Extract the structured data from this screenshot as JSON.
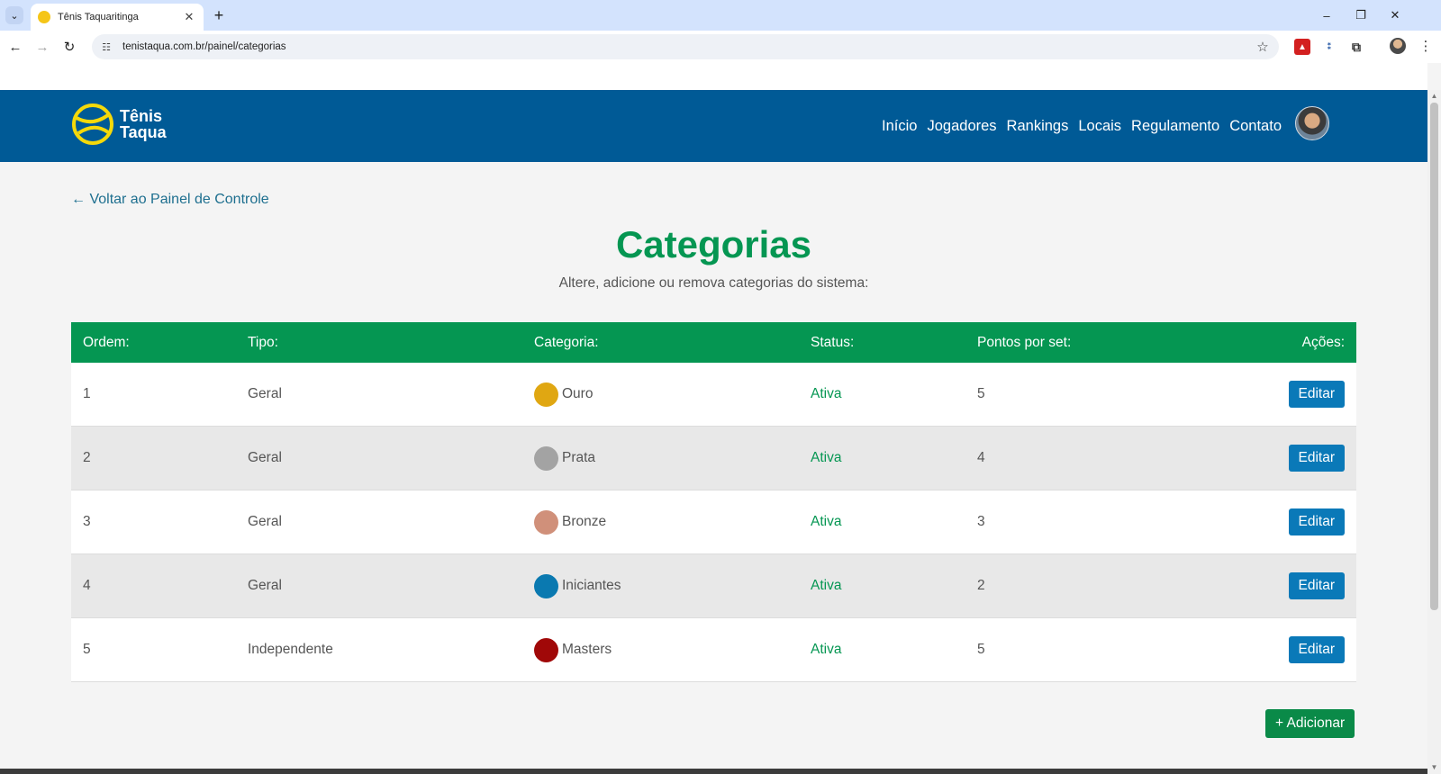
{
  "browser": {
    "tab_title": "Tênis Taquaritinga",
    "url": "tenistaqua.com.br/painel/categorias"
  },
  "header": {
    "logo_line1": "Tênis",
    "logo_line2": "Taqua",
    "nav": [
      "Início",
      "Jogadores",
      "Rankings",
      "Locais",
      "Regulamento",
      "Contato"
    ]
  },
  "page": {
    "back_link": "← Voltar ao Painel de Controle",
    "title": "Categorias",
    "subtitle": "Altere, adicione ou remova categorias do sistema:"
  },
  "table": {
    "headers": {
      "ordem": "Ordem:",
      "tipo": "Tipo:",
      "categoria": "Categoria:",
      "status": "Status:",
      "pontos": "Pontos por set:",
      "acoes": "Ações:"
    },
    "rows": [
      {
        "ordem": "1",
        "tipo": "Geral",
        "categoria": "Ouro",
        "color": "#e0a712",
        "status": "Ativa",
        "pontos": "5",
        "action": "Editar"
      },
      {
        "ordem": "2",
        "tipo": "Geral",
        "categoria": "Prata",
        "color": "#a3a3a3",
        "status": "Ativa",
        "pontos": "4",
        "action": "Editar"
      },
      {
        "ordem": "3",
        "tipo": "Geral",
        "categoria": "Bronze",
        "color": "#d0907a",
        "status": "Ativa",
        "pontos": "3",
        "action": "Editar"
      },
      {
        "ordem": "4",
        "tipo": "Geral",
        "categoria": "Iniciantes",
        "color": "#0a79b0",
        "status": "Ativa",
        "pontos": "2",
        "action": "Editar"
      },
      {
        "ordem": "5",
        "tipo": "Independente",
        "categoria": "Masters",
        "color": "#a00808",
        "status": "Ativa",
        "pontos": "5",
        "action": "Editar"
      }
    ]
  },
  "add_button": "+ Adicionar",
  "colors": {
    "header_blue": "#005a96",
    "green": "#059652",
    "edit_blue": "#0a79b8"
  }
}
